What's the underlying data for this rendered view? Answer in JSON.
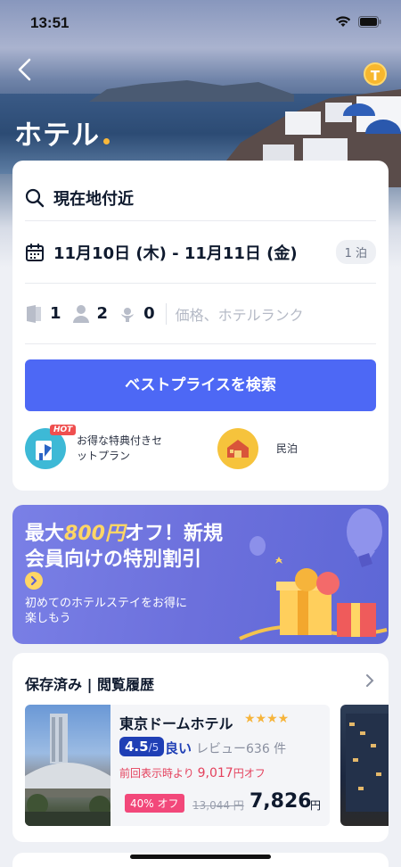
{
  "status_bar": {
    "time": "13:51"
  },
  "header": {
    "title": "ホテル",
    "coin_letter": "T"
  },
  "search": {
    "location": "現在地付近",
    "dates": "11月10日 (木) - 11月11日 (金)",
    "nights": "1 泊",
    "rooms": "1",
    "adults": "2",
    "children": "0",
    "price_placeholder": "価格、ホテルランク",
    "button_label": "ベストプライスを検索"
  },
  "promos": [
    {
      "label_line1": "お得な特典付きセ",
      "label_line2": "ットプラン",
      "badge": "HOT",
      "icon": "gift-plan-icon"
    },
    {
      "label": "民泊",
      "icon": "house-icon"
    }
  ],
  "banner": {
    "line1_prefix": "最大",
    "line1_highlight": "800円",
    "line1_suffix": "オフ！新規",
    "line2": "会員向けの特別割引",
    "sub_line1": "初めてのホテルステイをお得に",
    "sub_line2": "楽しもう"
  },
  "saved": {
    "title": "保存済み | 閲覧履歴",
    "hotels": [
      {
        "name": "東京ドームホテル",
        "stars": "★★★★",
        "score": "4.5",
        "score_den": "/5",
        "score_word": "良い",
        "reviews": "レビュー636 件",
        "discount_prefix": "前回表示時より",
        "discount_amount": "9,017",
        "discount_suffix": "円オフ",
        "off_tag": "40% オフ",
        "old_price": "13,044 円",
        "new_price": "7,826",
        "currency": "円"
      }
    ]
  },
  "colors": {
    "accent": "#4d68f5",
    "star": "#f6b43b",
    "discount": "#e4405c",
    "banner": "#6c70dc",
    "score_badge": "#1f3fb5"
  }
}
